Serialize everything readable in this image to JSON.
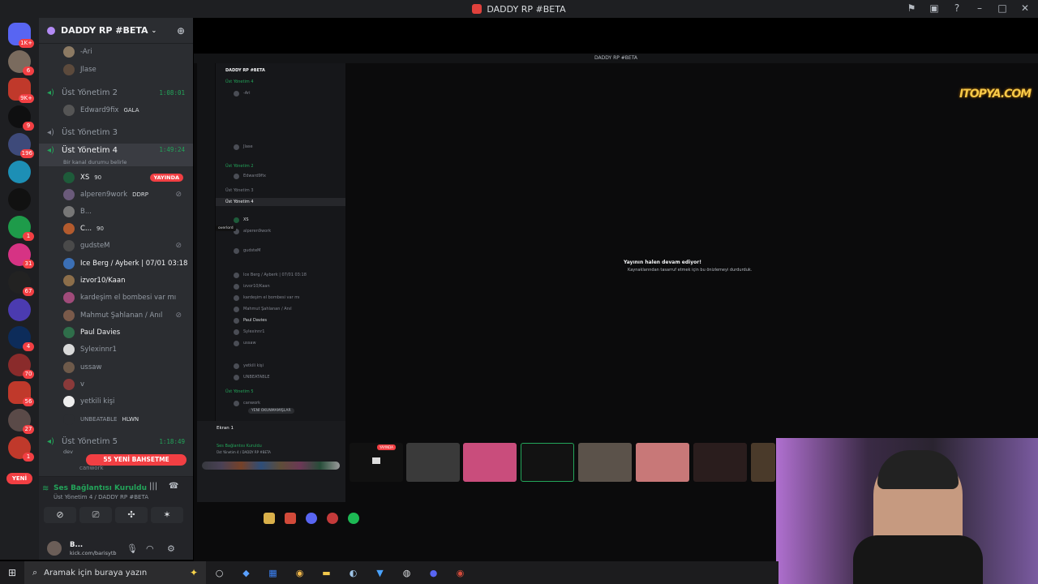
{
  "window": {
    "title": "DADDY RP #BETA"
  },
  "rail": {
    "badges": [
      "1K+",
      "6",
      "9K+",
      "9",
      "196",
      "1",
      "31",
      "67",
      "4",
      "70",
      "56",
      "27",
      "1"
    ],
    "new_label": "YENİ"
  },
  "server": {
    "name": "DADDY RP #BETA"
  },
  "channels": {
    "top_users": [
      "-Ari",
      "Jlase"
    ],
    "ch2": {
      "name": "Üst Yönetim 2",
      "time": "1:08:01",
      "users": [
        {
          "name": "Edward9fix",
          "tag": "GALA"
        }
      ]
    },
    "ch3": {
      "name": "Üst Yönetim 3"
    },
    "ch4": {
      "name": "Üst Yönetim 4",
      "time": "1:49:24",
      "status": "Bir kanal durumu belirle",
      "live_label": "YAYINDA",
      "users": [
        {
          "name": "XS",
          "tag": "90"
        },
        {
          "name": "alperen9work",
          "tag": "DDRP"
        },
        {
          "name": "B...",
          "tag": ""
        },
        {
          "name": "C...",
          "tag": "90"
        },
        {
          "name": "gudsteM",
          "tag": ""
        },
        {
          "name": "Ice Berg / Ayberk | 07/01 03:18",
          "tag": ""
        },
        {
          "name": "izvor10/Kaan",
          "tag": ""
        },
        {
          "name": "kardeşim el bombesi var mı",
          "tag": ""
        },
        {
          "name": "Mahmut Şahlanan / Anıl",
          "tag": ""
        },
        {
          "name": "Paul Davies",
          "tag": ""
        },
        {
          "name": "Sylexinnr1",
          "tag": ""
        },
        {
          "name": "ussaw",
          "tag": ""
        },
        {
          "name": "v",
          "tag": ""
        },
        {
          "name": "yetkili kişi",
          "tag": ""
        },
        {
          "name": "UNBEATABLE",
          "tag": "HLWN"
        }
      ]
    },
    "ch5": {
      "name": "Üst Yönetim 5",
      "time": "1:18:49",
      "status": "dev"
    },
    "new_messages": "55 YENİ BAHSETME",
    "trailing_user": "canwork"
  },
  "voice": {
    "title": "Ses Bağlantısı Kuruldu",
    "subtitle": "Üst Yönetim 4 / DADDY RP #BETA"
  },
  "user": {
    "name": "B...",
    "status": "kick.com/barisytb"
  },
  "stream": {
    "mini_title": "DADDY RP #BETA",
    "message_title": "Yayının halen devam ediyor!",
    "message_sub": "Kaynaklarından tasarruf etmek için bu önizlemeyi durdurduk.",
    "watermark": "ITOPYA.COM",
    "live_label": "YAYINDA",
    "screen_label": "Ekran 1",
    "hover_label": "overlord",
    "unread_label": "YENİ OKUNMAMIŞLAR"
  },
  "taskbar": {
    "search_placeholder": "Aramak için buraya yazın"
  },
  "colors": {
    "accent_green": "#23a55a",
    "alert_red": "#f23f43",
    "sidebar_bg": "#2b2d31",
    "rail_bg": "#1e1f22"
  }
}
